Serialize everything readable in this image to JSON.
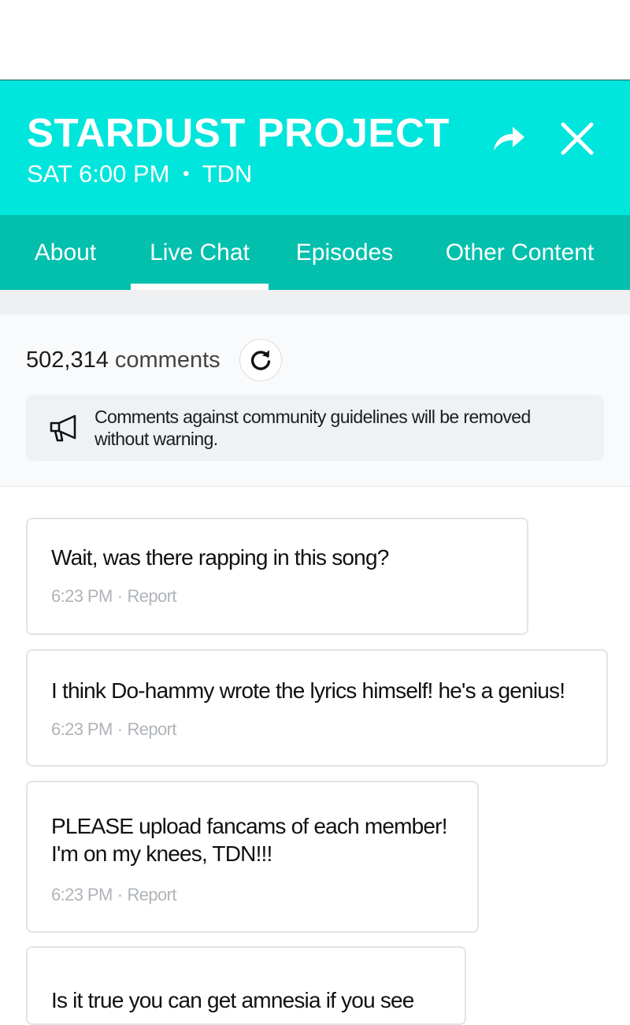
{
  "header": {
    "title": "STARDUST PROJECT",
    "schedule": "SAT 6:00 PM",
    "separator": "•",
    "network": "TDN",
    "share_icon": "share-arrow-icon",
    "close_icon": "close-icon"
  },
  "tabs": [
    {
      "label": "About",
      "active": false
    },
    {
      "label": "Live Chat",
      "active": true
    },
    {
      "label": "Episodes",
      "active": false
    },
    {
      "label": "Other Content",
      "active": false
    }
  ],
  "chat": {
    "count": "502,314",
    "count_label": "comments",
    "refresh_icon": "refresh-icon",
    "notice_icon": "megaphone-icon",
    "notice": "Comments against community guidelines will be removed without warning."
  },
  "comments": [
    {
      "text": "Wait, was there rapping in this song?",
      "time": "6:23 PM",
      "action": "Report"
    },
    {
      "text": "I think Do-hammy wrote the lyrics himself! he's a genius!",
      "time": "6:23 PM",
      "action": "Report"
    },
    {
      "text": "PLEASE upload fancams of each member! I'm on my knees, TDN!!!",
      "time": "6:23 PM",
      "action": "Report"
    },
    {
      "text": "Is it true you can get amnesia if you see",
      "time": "",
      "action": ""
    }
  ],
  "colors": {
    "header_bg": "#00e5dc",
    "tabs_bg": "#03c0ad",
    "text": "#111111",
    "meta": "#b0b4b8"
  },
  "meta_separator": "·"
}
